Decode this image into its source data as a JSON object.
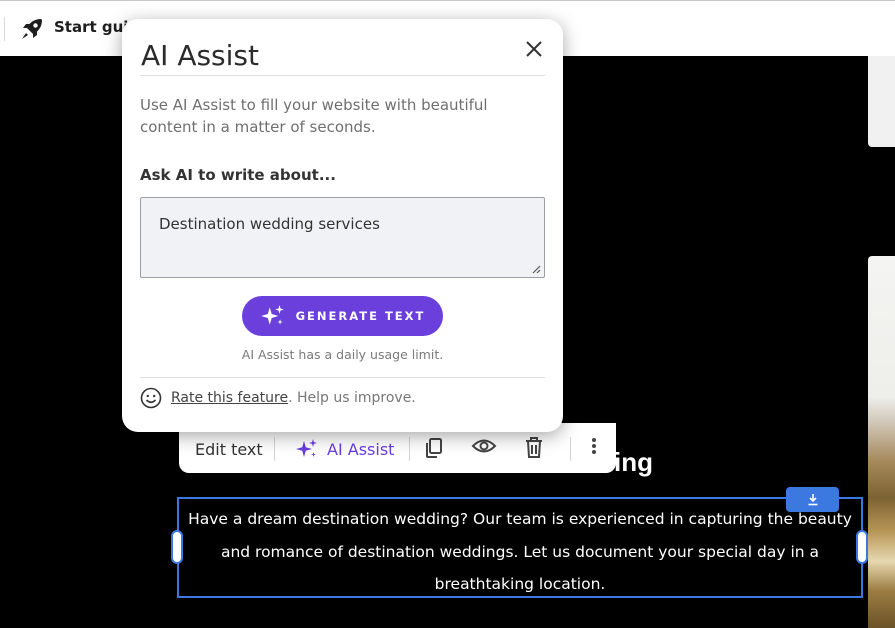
{
  "topbar": {
    "guide_label": "Start guid"
  },
  "heading_fragment": "ing",
  "toolbar": {
    "edit_text": "Edit text",
    "ai_assist": "AI Assist",
    "icons": [
      "copy-icon",
      "eye-icon",
      "trash-icon",
      "more-vertical-icon"
    ]
  },
  "content": {
    "body_text": "Have a dream destination wedding? Our team is experienced in capturing the beauty and romance of destination weddings. Let us document your special day in a breathtaking location."
  },
  "modal": {
    "title": "AI Assist",
    "description": "Use AI Assist to fill your website with beautiful content in a matter of seconds.",
    "ask_label": "Ask AI to write about...",
    "input_value": "Destination wedding services",
    "generate_label": "GENERATE TEXT",
    "limit_note": "AI Assist has a daily usage limit.",
    "rate_link": "Rate this feature",
    "rate_rest": ". Help us improve."
  },
  "colors": {
    "accent": "#6a3fdc",
    "selection": "#3b79e0",
    "background": "#000000"
  }
}
